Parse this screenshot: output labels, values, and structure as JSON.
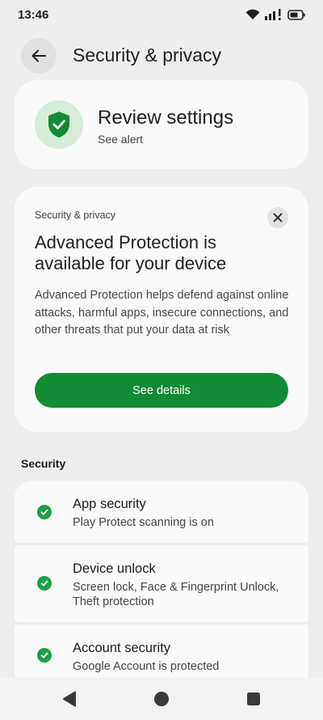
{
  "status_bar": {
    "time": "13:46",
    "icons": [
      "wifi-icon",
      "signal-icon",
      "battery-icon"
    ]
  },
  "header": {
    "back_icon": "arrow-back-icon",
    "title": "Security & privacy"
  },
  "review_card": {
    "icon": "shield-check-icon",
    "title": "Review settings",
    "subtitle": "See alert"
  },
  "promo_card": {
    "eyebrow": "Security & privacy",
    "close_icon": "close-icon",
    "title": "Advanced Protection is available for your device",
    "body": "Advanced Protection helps defend against online attacks, harmful apps, insecure connections, and other threats that put your data at risk",
    "button_label": "See details"
  },
  "security_section": {
    "heading": "Security",
    "items": [
      {
        "title": "App security",
        "subtitle": "Play Protect scanning is on",
        "icon": "check-circle-icon"
      },
      {
        "title": "Device unlock",
        "subtitle": "Screen lock, Face & Fingerprint Unlock, Theft protection",
        "icon": "check-circle-icon"
      },
      {
        "title": "Account security",
        "subtitle": "Google Account is protected",
        "icon": "check-circle-icon"
      }
    ]
  },
  "colors": {
    "accent_green": "#138a36",
    "check_green": "#1e9e4a",
    "background": "#eeeeee",
    "card": "#fafafa"
  }
}
